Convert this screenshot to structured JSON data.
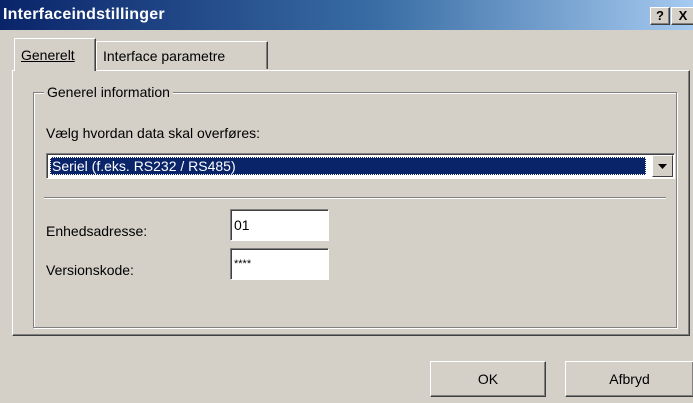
{
  "window": {
    "title": "Interfaceindstillinger",
    "help_button": "?",
    "close_button": "X"
  },
  "tabs": [
    {
      "label": "Generelt",
      "active": true
    },
    {
      "label": "Interface parametre",
      "active": false
    }
  ],
  "group": {
    "title": "Generel information",
    "transfer_label": "Vælg hvordan data skal overføres:",
    "transfer_value": "Seriel (f.eks. RS232 / RS485)",
    "address_label": "Enhedsadresse:",
    "address_value": "01",
    "version_label": "Versionskode:",
    "version_value": "****"
  },
  "buttons": {
    "ok": "OK",
    "cancel": "Afbryd"
  },
  "colors": {
    "titlebar_start": "#0a246a",
    "titlebar_end": "#a6caf0",
    "face": "#d4d0c8",
    "selection": "#0a246a"
  }
}
